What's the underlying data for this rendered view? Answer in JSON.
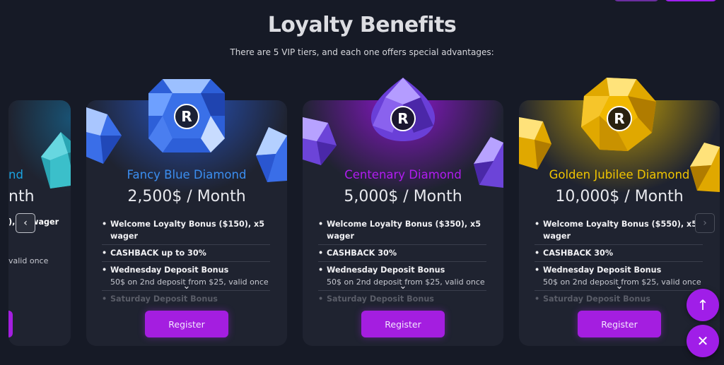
{
  "header": {
    "title": "Loyalty Benefits",
    "subtitle": "There are 5 VIP tiers, and each one offers special advantages:"
  },
  "partial_card": {
    "tier_fragment": "nd",
    "price_fragment": "nth",
    "benefit_fragment_1": "), x5 wager",
    "benefit_fragment_2": "valid once"
  },
  "cards": [
    {
      "tier": "Fancy Blue Diamond",
      "tier_color": "#3b8ef0",
      "price": "2,500$ / Month",
      "benefits": {
        "b1": "Welcome Loyalty Bonus ($150), x5 wager",
        "b2": "CASHBACK up to 30%",
        "b3": "Wednesday Deposit Bonus",
        "b3_sub": "50$ on 2nd deposit from $25, valid once",
        "b4": "Saturday Deposit Bonus"
      },
      "register": "Register"
    },
    {
      "tier": "Centenary Diamond",
      "tier_color": "#b01cf0",
      "price": "5,000$ / Month",
      "benefits": {
        "b1": "Welcome Loyalty Bonus ($350), x5 wager",
        "b2": "CASHBACK 30%",
        "b3": "Wednesday Deposit Bonus",
        "b3_sub": "50$ on 2nd deposit from $25, valid once",
        "b4": "Saturday Deposit Bonus"
      },
      "register": "Register"
    },
    {
      "tier": "Golden Jubilee Diamond",
      "tier_color": "#f0c400",
      "price": "10,000$ / Month",
      "benefits": {
        "b1": "Welcome Loyalty Bonus ($550), x5 wager",
        "b2": "CASHBACK 30%",
        "b3": "Wednesday Deposit Bonus",
        "b3_sub": "50$ on 2nd deposit from $25, valid once",
        "b4": "Saturday Deposit Bonus"
      },
      "register": "Register"
    }
  ],
  "carousel": {
    "prev_icon": "chevron-left-icon",
    "next_icon": "chevron-right-icon"
  },
  "fabs": {
    "scroll_top_icon": "arrow-up-icon",
    "close_icon": "close-icon"
  },
  "colors": {
    "accent": "#a41ee0",
    "background": "#161a26",
    "card": "#1f2330"
  }
}
